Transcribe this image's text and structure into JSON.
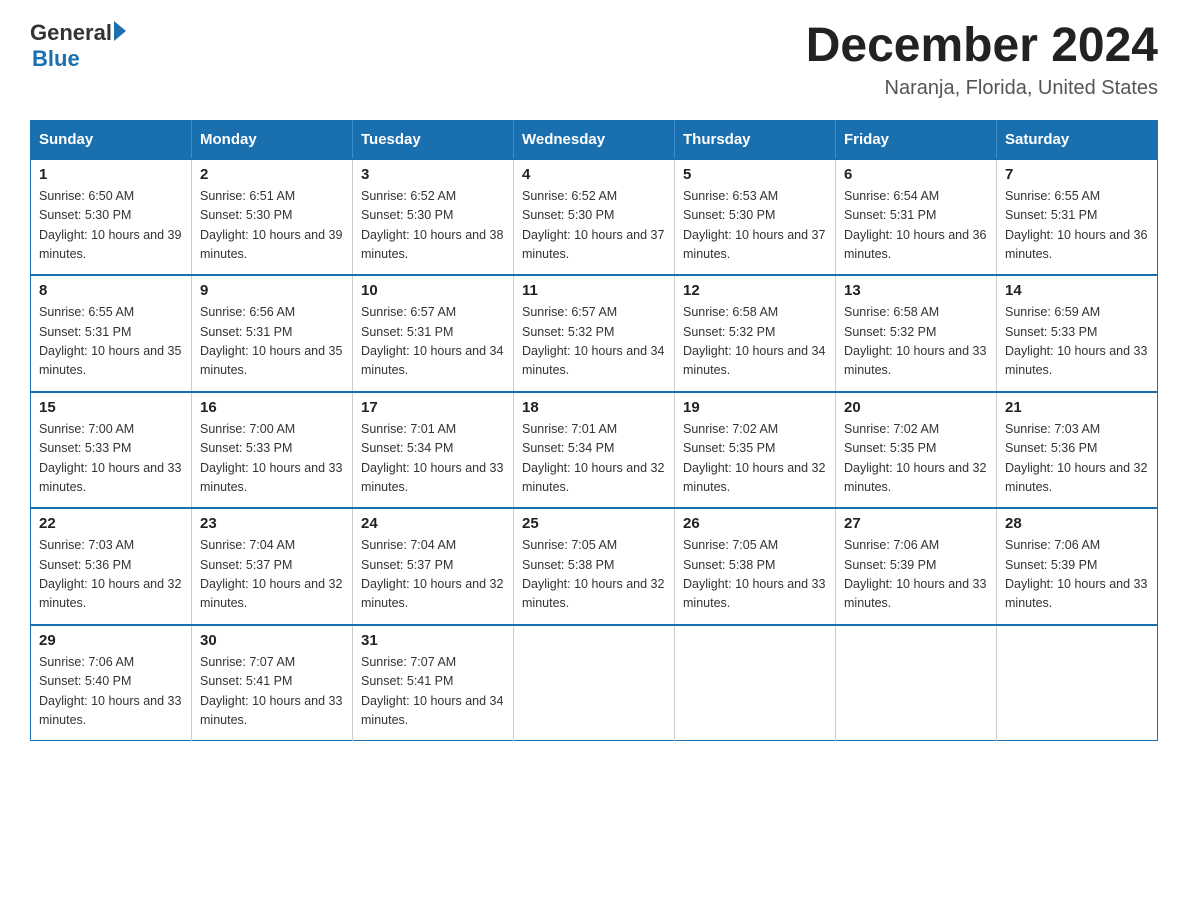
{
  "logo": {
    "general": "General",
    "blue": "Blue",
    "arrow": "▶"
  },
  "header": {
    "month_title": "December 2024",
    "location": "Naranja, Florida, United States"
  },
  "weekdays": [
    "Sunday",
    "Monday",
    "Tuesday",
    "Wednesday",
    "Thursday",
    "Friday",
    "Saturday"
  ],
  "weeks": [
    [
      {
        "day": "1",
        "sunrise": "6:50 AM",
        "sunset": "5:30 PM",
        "daylight": "10 hours and 39 minutes."
      },
      {
        "day": "2",
        "sunrise": "6:51 AM",
        "sunset": "5:30 PM",
        "daylight": "10 hours and 39 minutes."
      },
      {
        "day": "3",
        "sunrise": "6:52 AM",
        "sunset": "5:30 PM",
        "daylight": "10 hours and 38 minutes."
      },
      {
        "day": "4",
        "sunrise": "6:52 AM",
        "sunset": "5:30 PM",
        "daylight": "10 hours and 37 minutes."
      },
      {
        "day": "5",
        "sunrise": "6:53 AM",
        "sunset": "5:30 PM",
        "daylight": "10 hours and 37 minutes."
      },
      {
        "day": "6",
        "sunrise": "6:54 AM",
        "sunset": "5:31 PM",
        "daylight": "10 hours and 36 minutes."
      },
      {
        "day": "7",
        "sunrise": "6:55 AM",
        "sunset": "5:31 PM",
        "daylight": "10 hours and 36 minutes."
      }
    ],
    [
      {
        "day": "8",
        "sunrise": "6:55 AM",
        "sunset": "5:31 PM",
        "daylight": "10 hours and 35 minutes."
      },
      {
        "day": "9",
        "sunrise": "6:56 AM",
        "sunset": "5:31 PM",
        "daylight": "10 hours and 35 minutes."
      },
      {
        "day": "10",
        "sunrise": "6:57 AM",
        "sunset": "5:31 PM",
        "daylight": "10 hours and 34 minutes."
      },
      {
        "day": "11",
        "sunrise": "6:57 AM",
        "sunset": "5:32 PM",
        "daylight": "10 hours and 34 minutes."
      },
      {
        "day": "12",
        "sunrise": "6:58 AM",
        "sunset": "5:32 PM",
        "daylight": "10 hours and 34 minutes."
      },
      {
        "day": "13",
        "sunrise": "6:58 AM",
        "sunset": "5:32 PM",
        "daylight": "10 hours and 33 minutes."
      },
      {
        "day": "14",
        "sunrise": "6:59 AM",
        "sunset": "5:33 PM",
        "daylight": "10 hours and 33 minutes."
      }
    ],
    [
      {
        "day": "15",
        "sunrise": "7:00 AM",
        "sunset": "5:33 PM",
        "daylight": "10 hours and 33 minutes."
      },
      {
        "day": "16",
        "sunrise": "7:00 AM",
        "sunset": "5:33 PM",
        "daylight": "10 hours and 33 minutes."
      },
      {
        "day": "17",
        "sunrise": "7:01 AM",
        "sunset": "5:34 PM",
        "daylight": "10 hours and 33 minutes."
      },
      {
        "day": "18",
        "sunrise": "7:01 AM",
        "sunset": "5:34 PM",
        "daylight": "10 hours and 32 minutes."
      },
      {
        "day": "19",
        "sunrise": "7:02 AM",
        "sunset": "5:35 PM",
        "daylight": "10 hours and 32 minutes."
      },
      {
        "day": "20",
        "sunrise": "7:02 AM",
        "sunset": "5:35 PM",
        "daylight": "10 hours and 32 minutes."
      },
      {
        "day": "21",
        "sunrise": "7:03 AM",
        "sunset": "5:36 PM",
        "daylight": "10 hours and 32 minutes."
      }
    ],
    [
      {
        "day": "22",
        "sunrise": "7:03 AM",
        "sunset": "5:36 PM",
        "daylight": "10 hours and 32 minutes."
      },
      {
        "day": "23",
        "sunrise": "7:04 AM",
        "sunset": "5:37 PM",
        "daylight": "10 hours and 32 minutes."
      },
      {
        "day": "24",
        "sunrise": "7:04 AM",
        "sunset": "5:37 PM",
        "daylight": "10 hours and 32 minutes."
      },
      {
        "day": "25",
        "sunrise": "7:05 AM",
        "sunset": "5:38 PM",
        "daylight": "10 hours and 32 minutes."
      },
      {
        "day": "26",
        "sunrise": "7:05 AM",
        "sunset": "5:38 PM",
        "daylight": "10 hours and 33 minutes."
      },
      {
        "day": "27",
        "sunrise": "7:06 AM",
        "sunset": "5:39 PM",
        "daylight": "10 hours and 33 minutes."
      },
      {
        "day": "28",
        "sunrise": "7:06 AM",
        "sunset": "5:39 PM",
        "daylight": "10 hours and 33 minutes."
      }
    ],
    [
      {
        "day": "29",
        "sunrise": "7:06 AM",
        "sunset": "5:40 PM",
        "daylight": "10 hours and 33 minutes."
      },
      {
        "day": "30",
        "sunrise": "7:07 AM",
        "sunset": "5:41 PM",
        "daylight": "10 hours and 33 minutes."
      },
      {
        "day": "31",
        "sunrise": "7:07 AM",
        "sunset": "5:41 PM",
        "daylight": "10 hours and 34 minutes."
      },
      null,
      null,
      null,
      null
    ]
  ]
}
